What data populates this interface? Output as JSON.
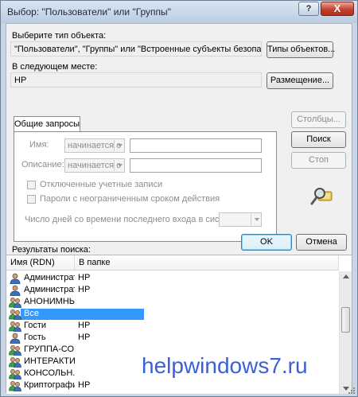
{
  "window": {
    "title": "Выбор: \"Пользователи\" или \"Группы\"",
    "help_label": "?",
    "close_label": "X"
  },
  "object_type": {
    "label": "Выберите тип объекта:",
    "value": "\"Пользователи\", \"Группы\" или \"Встроенные субъекты безопасности\"",
    "button_label": "Типы объектов..."
  },
  "location": {
    "label": "В следующем месте:",
    "value": "HP",
    "button_label": "Размещение..."
  },
  "tab": {
    "label": "Общие запросы",
    "name_label": "Имя:",
    "name_mode": "начинается с",
    "desc_label": "Описание:",
    "desc_mode": "начинается с",
    "disabled_accounts_label": "Отключенные учетные записи",
    "no_expire_label": "Пароли с неограниченным сроком действия",
    "days_label": "Число дней со времени последнего входа в систему:"
  },
  "side_buttons": {
    "columns_label": "Столбцы...",
    "search_label": "Поиск",
    "stop_label": "Стоп"
  },
  "footer": {
    "ok_label": "OK",
    "cancel_label": "Отмена"
  },
  "results": {
    "label": "Результаты поиска:",
    "col_name": "Имя (RDN)",
    "col_folder": "В папке",
    "rows": [
      {
        "name": "Администрат...",
        "folder": "HP",
        "icon": "user-icon"
      },
      {
        "name": "Администрат...",
        "folder": "HP",
        "icon": "user-icon"
      },
      {
        "name": "АНОНИМНЫ...",
        "folder": "",
        "icon": "group-icon"
      },
      {
        "name": "Все",
        "folder": "",
        "icon": "group-icon",
        "selected": true
      },
      {
        "name": "Гости",
        "folder": "HP",
        "icon": "group-icon"
      },
      {
        "name": "Гость",
        "folder": "HP",
        "icon": "user-icon"
      },
      {
        "name": "ГРУППА-СО...",
        "folder": "",
        "icon": "group-icon"
      },
      {
        "name": "ИНТЕРАКТИ...",
        "folder": "",
        "icon": "group-icon"
      },
      {
        "name": "КОНСОЛЬН...",
        "folder": "",
        "icon": "group-icon"
      },
      {
        "name": "Криптографи...",
        "folder": "HP",
        "icon": "group-icon"
      }
    ]
  },
  "watermark": "helpwindows7.ru",
  "colors": {
    "selection": "#3399ff",
    "watermark": "#3a5fd9",
    "close_button": "#c4402e"
  }
}
